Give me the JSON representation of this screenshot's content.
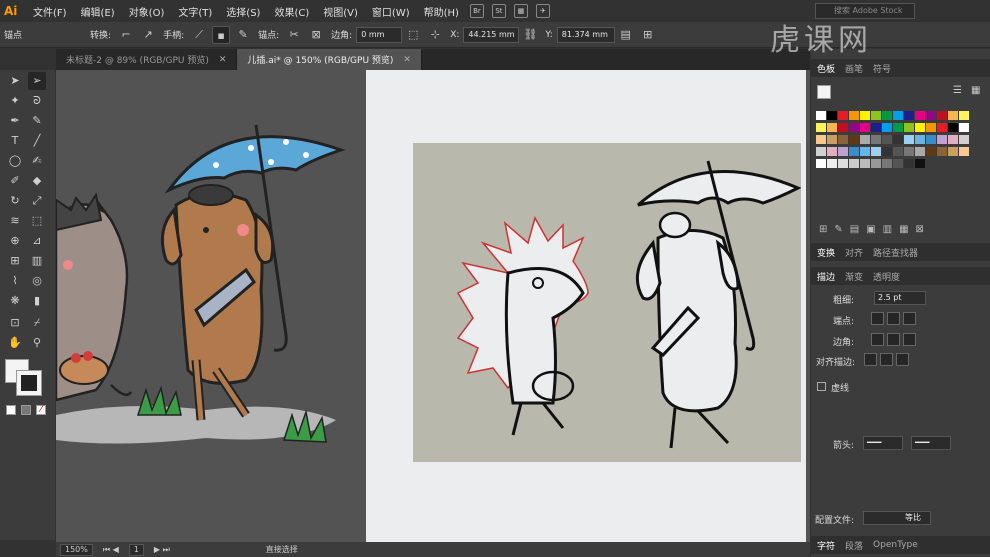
{
  "app": {
    "logo": "Ai",
    "workspace": "p1"
  },
  "menu": [
    "文件(F)",
    "编辑(E)",
    "对象(O)",
    "文字(T)",
    "选择(S)",
    "效果(C)",
    "视图(V)",
    "窗口(W)",
    "帮助(H)"
  ],
  "search_placeholder": "搜索 Adobe Stock",
  "control": {
    "anchor_label": "锚点",
    "convert_label": "转换:",
    "handle_label": "手柄:",
    "anchor2_label": "锚点:",
    "corner_label": "边角:",
    "corner_value": "0 mm",
    "x_label": "X:",
    "x_value": "44.215 mm",
    "y_label": "Y:",
    "y_value": "81.374 mm"
  },
  "tabs": [
    {
      "label": "未标题-2 @ 89% (RGB/GPU 预览)",
      "active": false
    },
    {
      "label": "儿插.ai* @ 150% (RGB/GPU 预览)",
      "active": true
    }
  ],
  "status": {
    "zoom": "150%",
    "page": "1",
    "tool": "直接选择"
  },
  "panels": {
    "top_tabs": [
      "色板",
      "画笔",
      "符号"
    ],
    "transform_tabs": [
      "变换",
      "对齐",
      "路径查找器"
    ],
    "stroke_tabs": [
      "描边",
      "渐变",
      "透明度"
    ],
    "weight_label": "粗细:",
    "weight_value": "2.5 pt",
    "cap_label": "端点:",
    "corner_label": "边角:",
    "align_label": "对齐描边:",
    "dashed_label": "虚线",
    "arrow_label": "箭头:",
    "profile_label": "配置文件:",
    "profile_value": "等比",
    "bottom_tabs": [
      "字符",
      "段落",
      "OpenType"
    ]
  },
  "watermark": "虎课网",
  "colors": {
    "accent": "#ff9a00",
    "swatch_row": [
      "#ffffff",
      "#000000",
      "#e31e24",
      "#f39800",
      "#fff100",
      "#8fc31f",
      "#009944",
      "#00a0e9",
      "#1d2088",
      "#e4007f",
      "#920783",
      "#c30d23",
      "#f8b551",
      "#fff45c"
    ]
  }
}
